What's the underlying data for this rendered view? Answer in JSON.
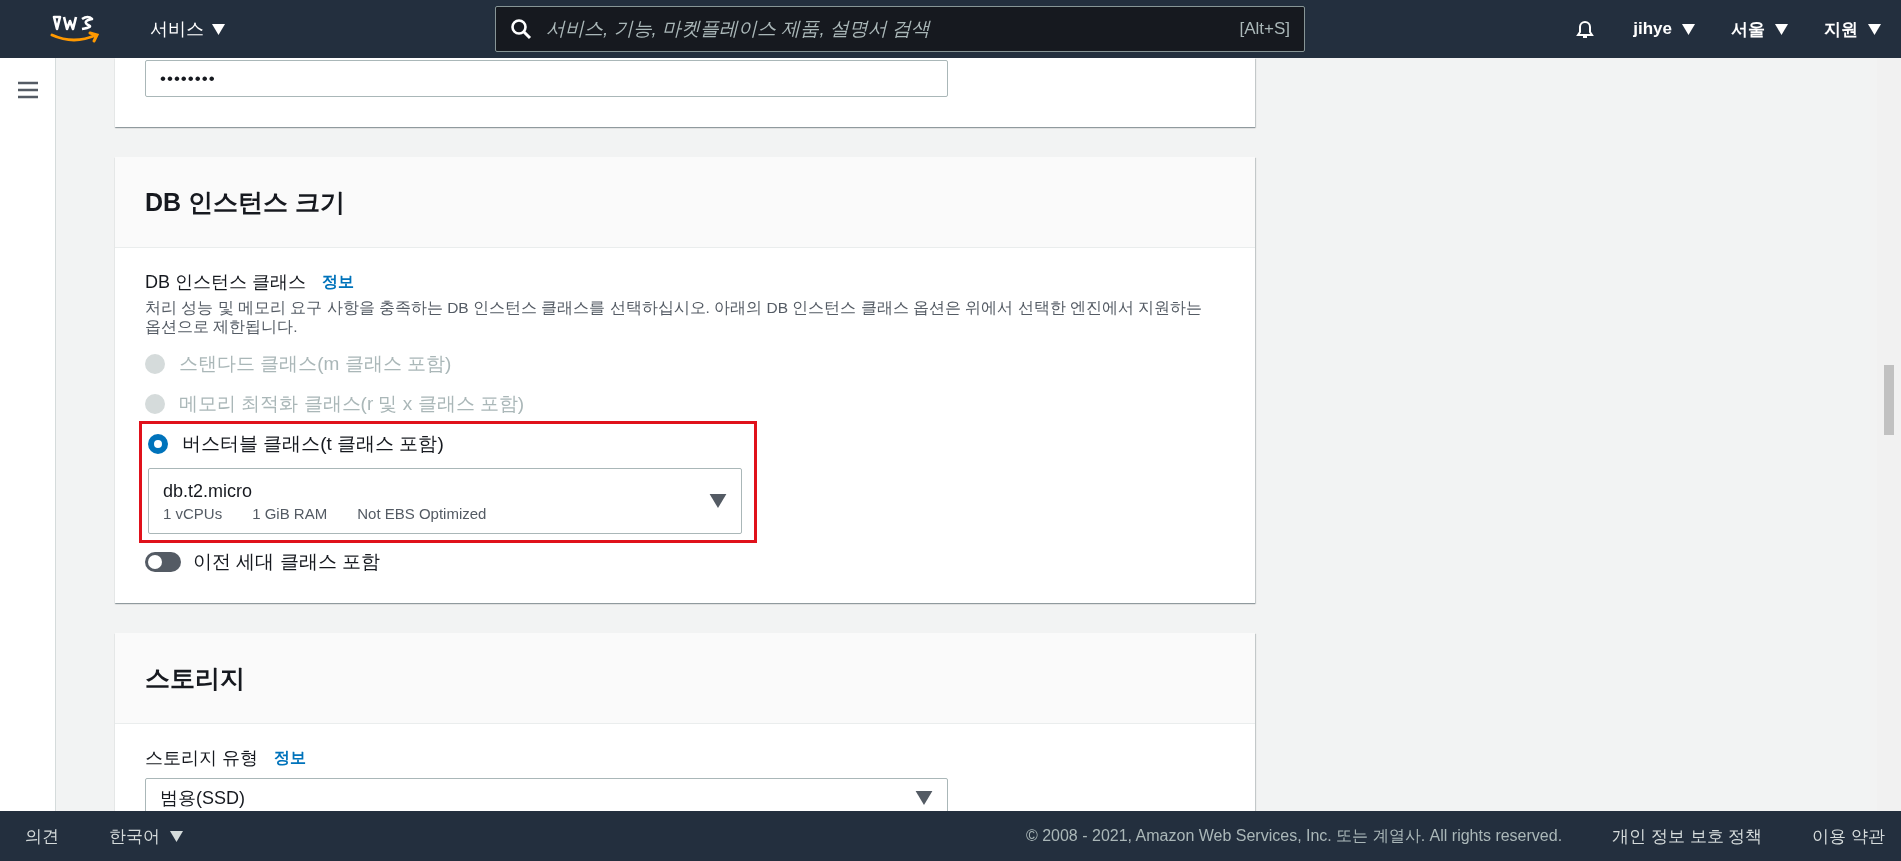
{
  "top_nav": {
    "services": "서비스",
    "search": {
      "placeholder": "서비스, 기능, 마켓플레이스 제품, 설명서 검색",
      "shortcut": "[Alt+S]"
    },
    "user": "jihye",
    "region": "서울",
    "support": "지원"
  },
  "password_field": {
    "value": "••••••••"
  },
  "instance_size": {
    "title": "DB 인스턴스 크기",
    "label": "DB 인스턴스 클래스",
    "info": "정보",
    "description": "처리 성능 및 메모리 요구 사항을 충족하는 DB 인스턴스 클래스를 선택하십시오. 아래의 DB 인스턴스 클래스 옵션은 위에서 선택한 엔진에서 지원하는 옵션으로 제한됩니다.",
    "highlight": true,
    "options": [
      {
        "label": "스탠다드 클래스(m 클래스 포함)",
        "selected": false,
        "disabled": true
      },
      {
        "label": "메모리 최적화 클래스(r 및 x 클래스 포함)",
        "selected": false,
        "disabled": true
      },
      {
        "label": "버스터블 클래스(t 클래스 포함)",
        "selected": true,
        "disabled": false
      }
    ],
    "select": {
      "value": "db.t2.micro",
      "details": [
        "1 vCPUs",
        "1 GiB RAM",
        "Not EBS Optimized"
      ]
    },
    "toggle": {
      "label": "이전 세대 클래스 포함",
      "on": false
    }
  },
  "storage": {
    "title": "스토리지",
    "label": "스토리지 유형",
    "info": "정보",
    "select": {
      "value": "범용(SSD)"
    }
  },
  "footer": {
    "feedback": "의견",
    "language": "한국어",
    "copyright": "© 2008 - 2021, Amazon Web Services, Inc. 또는 계열사. All rights reserved.",
    "links": [
      "개인 정보 보호 정책",
      "이용 약관"
    ]
  }
}
